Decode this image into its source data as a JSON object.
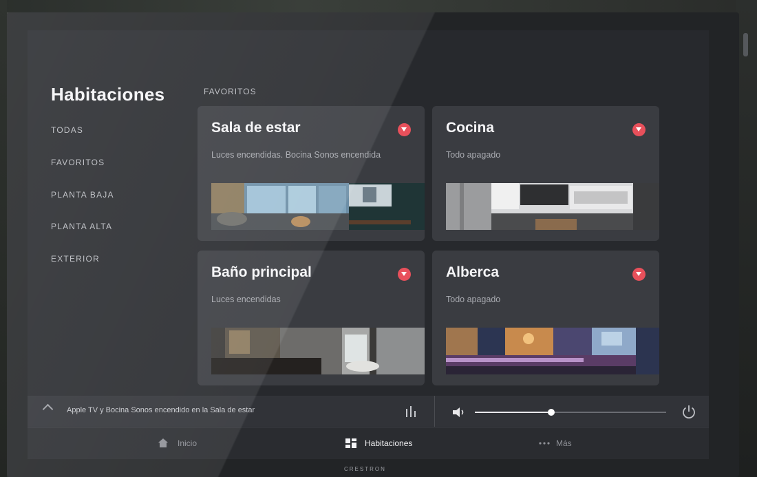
{
  "sidebar": {
    "title": "Habitaciones",
    "items": [
      {
        "label": "TODAS"
      },
      {
        "label": "FAVORITOS"
      },
      {
        "label": "PLANTA BAJA"
      },
      {
        "label": "PLANTA ALTA"
      },
      {
        "label": "EXTERIOR"
      }
    ]
  },
  "main": {
    "section_label": "FAVORITOS",
    "rooms": [
      {
        "name": "Sala de estar",
        "status": "Luces encendidas. Bocina Sonos encendida"
      },
      {
        "name": "Cocina",
        "status": "Todo apagado"
      },
      {
        "name": "Baño principal",
        "status": "Luces encendidas"
      },
      {
        "name": "Alberca",
        "status": "Todo apagado"
      }
    ]
  },
  "now_playing": {
    "text": "Apple TV y Bocina Sonos encendido en la Sala de estar",
    "volume": 0.4
  },
  "tabbar": {
    "tabs": [
      {
        "label": "Inicio",
        "icon": "home-icon"
      },
      {
        "label": "Habitaciones",
        "icon": "rooms-icon"
      },
      {
        "label": "Más",
        "icon": "more-icon"
      }
    ]
  },
  "brand": "CRESTRON",
  "colors": {
    "accent": "#e8505b",
    "card": "#3a3c41",
    "screen": "#27292d"
  }
}
